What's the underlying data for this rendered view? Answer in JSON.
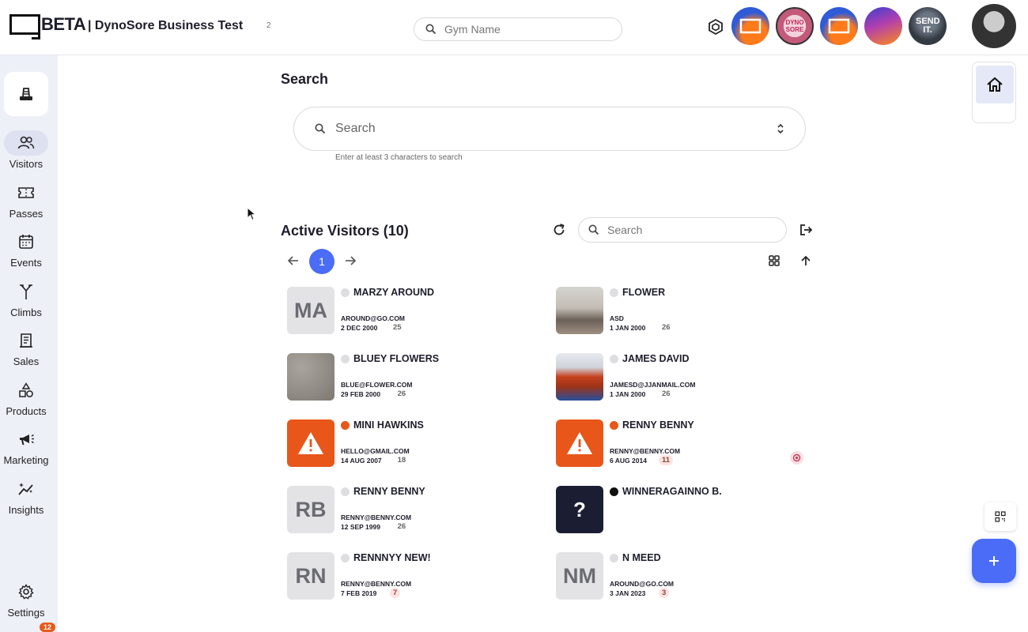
{
  "header": {
    "logo_text": "BETA",
    "gym_title": "| DynoSore Business Test",
    "gym_count": "2",
    "search_placeholder": "Gym Name",
    "gym_avatars": [
      {
        "label": "",
        "color": "#2f5bd8"
      },
      {
        "label": "DYNO SORE",
        "color": "#c35a7a"
      },
      {
        "label": "",
        "color": "#2f5bd8"
      },
      {
        "label": "",
        "color": "#5a4bc8"
      },
      {
        "label": "SEND IT.",
        "color": "#333a44"
      }
    ]
  },
  "sidebar": {
    "items": [
      {
        "label": "Visitors",
        "icon": "users-icon",
        "active": true
      },
      {
        "label": "Passes",
        "icon": "ticket-icon"
      },
      {
        "label": "Events",
        "icon": "calendar-icon"
      },
      {
        "label": "Climbs",
        "icon": "route-icon"
      },
      {
        "label": "Sales",
        "icon": "receipt-icon"
      },
      {
        "label": "Products",
        "icon": "shapes-icon"
      },
      {
        "label": "Marketing",
        "icon": "megaphone-icon"
      },
      {
        "label": "Insights",
        "icon": "sparkle-chart-icon"
      }
    ],
    "settings_label": "Settings",
    "settings_badge": "12"
  },
  "search": {
    "title": "Search",
    "placeholder": "Search",
    "hint": "Enter at least 3 characters to search"
  },
  "active": {
    "title": "Active Visitors (10)",
    "search_placeholder": "Search",
    "page": "1"
  },
  "visitors": [
    {
      "name": "MARZY AROUND",
      "email": "AROUND@GO.COM",
      "date": "2 DEC 2000",
      "age": "25",
      "thumb": "initials",
      "initials": "MA",
      "status": "grey"
    },
    {
      "name": "FLOWER",
      "email": "ASD",
      "date": "1 JAN 2000",
      "age": "26",
      "thumb": "photo-room",
      "initials": "",
      "status": "grey"
    },
    {
      "name": "BLUEY FLOWERS",
      "email": "BLUE@FLOWER.COM",
      "date": "29 FEB 2000",
      "age": "26",
      "thumb": "photo-rock",
      "initials": "",
      "status": "grey"
    },
    {
      "name": "JAMES DAVID",
      "email": "JAMESD@JJANMAIL.COM",
      "date": "1 JAN 2000",
      "age": "26",
      "thumb": "photo-person",
      "initials": "",
      "status": "grey"
    },
    {
      "name": "MINI HAWKINS",
      "email": "HELLO@GMAIL.COM",
      "date": "14 AUG 2007",
      "age": "18",
      "thumb": "warn",
      "initials": "",
      "status": "orange"
    },
    {
      "name": "RENNY BENNY",
      "email": "RENNY@BENNY.COM",
      "date": "6 AUG 2014",
      "age": "11",
      "thumb": "warn",
      "initials": "",
      "status": "orange",
      "age_pink": true
    },
    {
      "name": "RENNY BENNY",
      "email": "RENNY@BENNY.COM",
      "date": "12 SEP 1999",
      "age": "26",
      "thumb": "initials",
      "initials": "RB",
      "status": "grey"
    },
    {
      "name": "WINNERAGAINNO B.",
      "email": "",
      "date": "",
      "age": "",
      "thumb": "unknown",
      "initials": "?",
      "status": "dark"
    },
    {
      "name": "RENNNYY NEW!",
      "email": "RENNY@BENNY.COM",
      "date": "7 FEB 2019",
      "age": "7",
      "thumb": "initials",
      "initials": "RN",
      "status": "grey",
      "age_pink": true
    },
    {
      "name": "N MEED",
      "email": "AROUND@GO.COM",
      "date": "3 JAN 2023",
      "age": "3",
      "thumb": "initials",
      "initials": "NM",
      "status": "grey",
      "age_pink": true
    }
  ]
}
